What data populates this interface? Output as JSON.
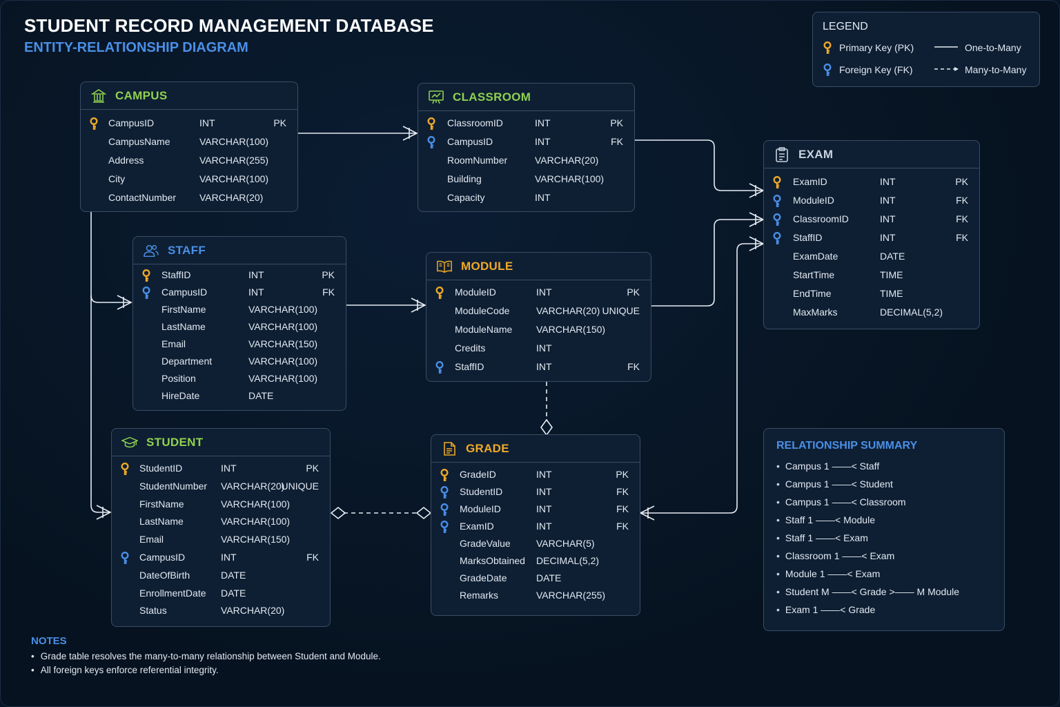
{
  "header": {
    "title": "STUDENT RECORD MANAGEMENT DATABASE",
    "subtitle": "ENTITY-RELATIONSHIP DIAGRAM"
  },
  "colors": {
    "pk": "#f0a928",
    "fk": "#4a8fe7",
    "campus": "#8fd14f",
    "classroom": "#8fd14f",
    "staff": "#4a8fe7",
    "module": "#f0a928",
    "exam": "#c9d3e0",
    "student": "#8fd14f",
    "grade": "#f0a928"
  },
  "legend": {
    "title": "LEGEND",
    "pk_label": "Primary Key (PK)",
    "fk_label": "Foreign Key (FK)",
    "one_to_many": "One-to-Many",
    "many_to_many": "Many-to-Many"
  },
  "entities": {
    "campus": {
      "name": "CAMPUS",
      "icon": "building-icon",
      "fields": [
        {
          "name": "CampusID",
          "type": "INT",
          "constraint": "PK",
          "key": "pk"
        },
        {
          "name": "CampusName",
          "type": "VARCHAR(100)",
          "constraint": "",
          "key": ""
        },
        {
          "name": "Address",
          "type": "VARCHAR(255)",
          "constraint": "",
          "key": ""
        },
        {
          "name": "City",
          "type": "VARCHAR(100)",
          "constraint": "",
          "key": ""
        },
        {
          "name": "ContactNumber",
          "type": "VARCHAR(20)",
          "constraint": "",
          "key": ""
        }
      ]
    },
    "classroom": {
      "name": "CLASSROOM",
      "icon": "presentation-board-icon",
      "fields": [
        {
          "name": "ClassroomID",
          "type": "INT",
          "constraint": "PK",
          "key": "pk"
        },
        {
          "name": "CampusID",
          "type": "INT",
          "constraint": "FK",
          "key": "fk"
        },
        {
          "name": "RoomNumber",
          "type": "VARCHAR(20)",
          "constraint": "",
          "key": ""
        },
        {
          "name": "Building",
          "type": "VARCHAR(100)",
          "constraint": "",
          "key": ""
        },
        {
          "name": "Capacity",
          "type": "INT",
          "constraint": "",
          "key": ""
        }
      ]
    },
    "exam": {
      "name": "EXAM",
      "icon": "clipboard-icon",
      "fields": [
        {
          "name": "ExamID",
          "type": "INT",
          "constraint": "PK",
          "key": "pk"
        },
        {
          "name": "ModuleID",
          "type": "INT",
          "constraint": "FK",
          "key": "fk"
        },
        {
          "name": "ClassroomID",
          "type": "INT",
          "constraint": "FK",
          "key": "fk"
        },
        {
          "name": "StaffID",
          "type": "INT",
          "constraint": "FK",
          "key": "fk"
        },
        {
          "name": "ExamDate",
          "type": "DATE",
          "constraint": "",
          "key": ""
        },
        {
          "name": "StartTime",
          "type": "TIME",
          "constraint": "",
          "key": ""
        },
        {
          "name": "EndTime",
          "type": "TIME",
          "constraint": "",
          "key": ""
        },
        {
          "name": "MaxMarks",
          "type": "DECIMAL(5,2)",
          "constraint": "",
          "key": ""
        }
      ]
    },
    "staff": {
      "name": "STAFF",
      "icon": "users-icon",
      "fields": [
        {
          "name": "StaffID",
          "type": "INT",
          "constraint": "PK",
          "key": "pk"
        },
        {
          "name": "CampusID",
          "type": "INT",
          "constraint": "FK",
          "key": "fk"
        },
        {
          "name": "FirstName",
          "type": "VARCHAR(100)",
          "constraint": "",
          "key": ""
        },
        {
          "name": "LastName",
          "type": "VARCHAR(100)",
          "constraint": "",
          "key": ""
        },
        {
          "name": "Email",
          "type": "VARCHAR(150)",
          "constraint": "",
          "key": ""
        },
        {
          "name": "Department",
          "type": "VARCHAR(100)",
          "constraint": "",
          "key": ""
        },
        {
          "name": "Position",
          "type": "VARCHAR(100)",
          "constraint": "",
          "key": ""
        },
        {
          "name": "HireDate",
          "type": "DATE",
          "constraint": "",
          "key": ""
        }
      ]
    },
    "module": {
      "name": "MODULE",
      "icon": "book-icon",
      "fields": [
        {
          "name": "ModuleID",
          "type": "INT",
          "constraint": "PK",
          "key": "pk"
        },
        {
          "name": "ModuleCode",
          "type": "VARCHAR(20)",
          "constraint": "UNIQUE",
          "key": ""
        },
        {
          "name": "ModuleName",
          "type": "VARCHAR(150)",
          "constraint": "",
          "key": ""
        },
        {
          "name": "Credits",
          "type": "INT",
          "constraint": "",
          "key": ""
        },
        {
          "name": "StaffID",
          "type": "INT",
          "constraint": "FK",
          "key": "fk"
        }
      ]
    },
    "student": {
      "name": "STUDENT",
      "icon": "graduation-cap-icon",
      "fields": [
        {
          "name": "StudentID",
          "type": "INT",
          "constraint": "PK",
          "key": "pk"
        },
        {
          "name": "StudentNumber",
          "type": "VARCHAR(20)",
          "constraint": "UNIQUE",
          "key": ""
        },
        {
          "name": "FirstName",
          "type": "VARCHAR(100)",
          "constraint": "",
          "key": ""
        },
        {
          "name": "LastName",
          "type": "VARCHAR(100)",
          "constraint": "",
          "key": ""
        },
        {
          "name": "Email",
          "type": "VARCHAR(150)",
          "constraint": "",
          "key": ""
        },
        {
          "name": "CampusID",
          "type": "INT",
          "constraint": "FK",
          "key": "fk"
        },
        {
          "name": "DateOfBirth",
          "type": "DATE",
          "constraint": "",
          "key": ""
        },
        {
          "name": "EnrollmentDate",
          "type": "DATE",
          "constraint": "",
          "key": ""
        },
        {
          "name": "Status",
          "type": "VARCHAR(20)",
          "constraint": "",
          "key": ""
        }
      ]
    },
    "grade": {
      "name": "GRADE",
      "icon": "document-icon",
      "fields": [
        {
          "name": "GradeID",
          "type": "INT",
          "constraint": "PK",
          "key": "pk"
        },
        {
          "name": "StudentID",
          "type": "INT",
          "constraint": "FK",
          "key": "fk"
        },
        {
          "name": "ModuleID",
          "type": "INT",
          "constraint": "FK",
          "key": "fk"
        },
        {
          "name": "ExamID",
          "type": "INT",
          "constraint": "FK",
          "key": "fk"
        },
        {
          "name": "GradeValue",
          "type": "VARCHAR(5)",
          "constraint": "",
          "key": ""
        },
        {
          "name": "MarksObtained",
          "type": "DECIMAL(5,2)",
          "constraint": "",
          "key": ""
        },
        {
          "name": "GradeDate",
          "type": "DATE",
          "constraint": "",
          "key": ""
        },
        {
          "name": "Remarks",
          "type": "VARCHAR(255)",
          "constraint": "",
          "key": ""
        }
      ]
    }
  },
  "summary": {
    "title": "RELATIONSHIP SUMMARY",
    "items": [
      "Campus 1 ——< Staff",
      "Campus 1 ——< Student",
      "Campus 1 ——< Classroom",
      "Staff 1 ——< Module",
      "Staff 1 ——< Exam",
      "Classroom 1 ——< Exam",
      "Module 1 ——< Exam",
      "Student M ——< Grade >—— M Module",
      "Exam 1 ——< Grade"
    ]
  },
  "notes": {
    "title": "NOTES",
    "items": [
      "Grade table resolves the many-to-many relationship between Student and Module.",
      "All foreign keys enforce referential integrity."
    ]
  }
}
